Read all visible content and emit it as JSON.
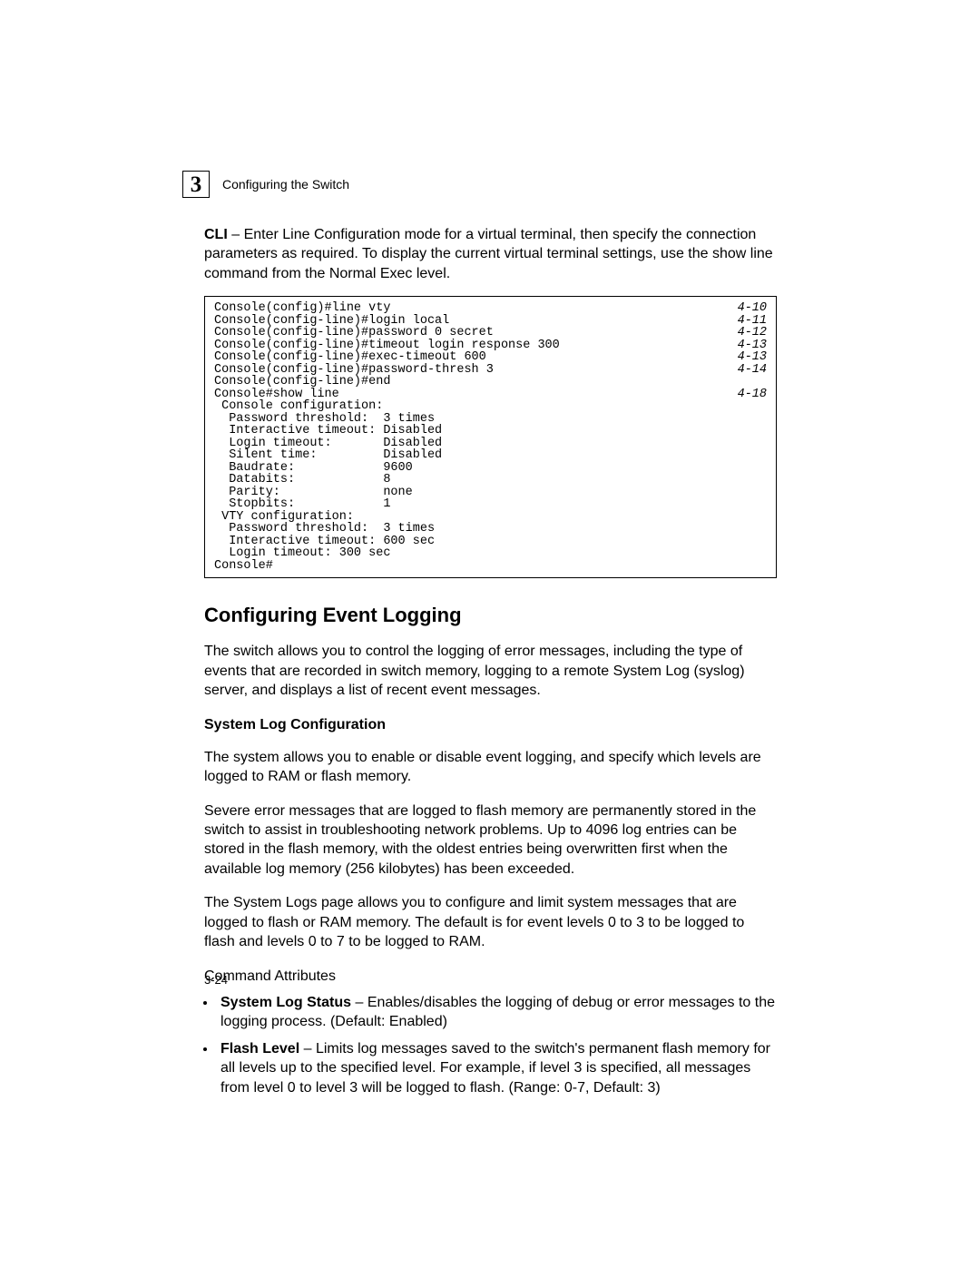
{
  "header": {
    "chapter_number": "3",
    "chapter_title": "Configuring the Switch"
  },
  "intro": {
    "prefix": "CLI",
    "text": " – Enter Line Configuration mode for a virtual terminal, then specify the connection parameters as required. To display the current virtual terminal settings, use the ",
    "cmd": "show line",
    "suffix": " command from the Normal Exec level."
  },
  "code": [
    {
      "left": "Console(config)#line vty",
      "ref": "4-10"
    },
    {
      "left": "Console(config-line)#login local",
      "ref": "4-11"
    },
    {
      "left": "Console(config-line)#password 0 secret",
      "ref": "4-12"
    },
    {
      "left": "Console(config-line)#timeout login response 300",
      "ref": "4-13"
    },
    {
      "left": "Console(config-line)#exec-timeout 600",
      "ref": "4-13"
    },
    {
      "left": "Console(config-line)#password-thresh 3",
      "ref": "4-14"
    },
    {
      "left": "Console(config-line)#end",
      "ref": ""
    },
    {
      "left": "Console#show line",
      "ref": "4-18"
    },
    {
      "left": " Console configuration:",
      "ref": ""
    },
    {
      "left": "  Password threshold:  3 times",
      "ref": ""
    },
    {
      "left": "  Interactive timeout: Disabled",
      "ref": ""
    },
    {
      "left": "  Login timeout:       Disabled",
      "ref": ""
    },
    {
      "left": "  Silent time:         Disabled",
      "ref": ""
    },
    {
      "left": "  Baudrate:            9600",
      "ref": ""
    },
    {
      "left": "  Databits:            8",
      "ref": ""
    },
    {
      "left": "  Parity:              none",
      "ref": ""
    },
    {
      "left": "  Stopbits:            1",
      "ref": ""
    },
    {
      "left": "",
      "ref": ""
    },
    {
      "left": " VTY configuration:",
      "ref": ""
    },
    {
      "left": "  Password threshold:  3 times",
      "ref": ""
    },
    {
      "left": "  Interactive timeout: 600 sec",
      "ref": ""
    },
    {
      "left": "  Login timeout: 300 sec",
      "ref": ""
    },
    {
      "left": "Console#",
      "ref": ""
    }
  ],
  "section": {
    "heading": "Configuring Event Logging",
    "para1": "The switch allows you to control the logging of error messages, including the type of events that are recorded in switch memory, logging to a remote System Log (syslog) server, and displays a list of recent event messages.",
    "sub_heading": "System Log Configuration",
    "para2": "The system allows you to enable or disable event logging, and specify which levels are logged to RAM or flash memory.",
    "para3": "Severe error messages that are logged to flash memory are permanently stored in the switch to assist in troubleshooting network problems. Up to 4096 log entries can be stored in the flash memory, with the oldest entries being overwritten first when the available log memory (256 kilobytes) has been exceeded.",
    "para4": "The System Logs page allows you to configure and limit system messages that are logged to flash or RAM memory. The default is for event levels 0 to 3 to be logged to flash and levels 0 to 7 to be logged to RAM.",
    "cmd_attr_label": "Command Attributes",
    "b1_label": "System Log Status",
    "b1_text": " – Enables/disables the logging of debug or error messages to the logging process. (Default: Enabled)",
    "b2_label": "Flash Level",
    "b2_text": " – Limits log messages saved to the switch's permanent flash memory for all levels up to the specified level. For example, if level 3 is specified, all messages from level 0 to level 3 will be logged to flash. (Range: 0-7, Default: 3)"
  },
  "footer": "3-24"
}
